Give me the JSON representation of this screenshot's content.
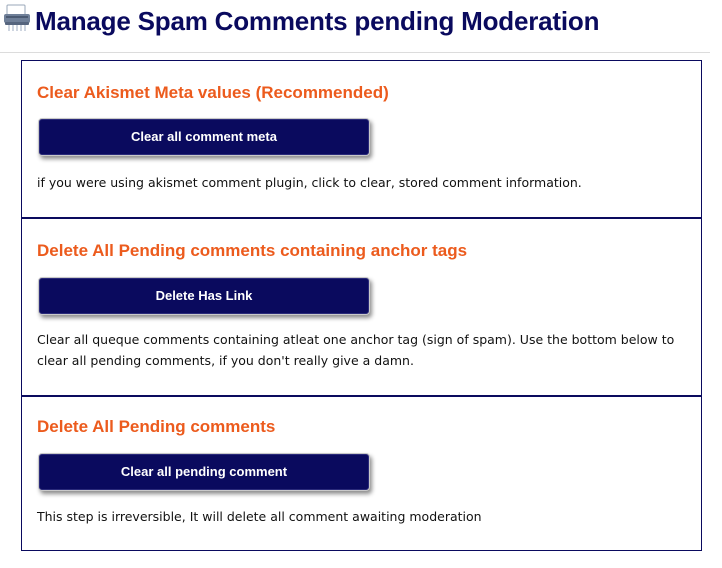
{
  "header": {
    "icon": "shredder-icon",
    "title": "Manage Spam Comments pending Moderation"
  },
  "sections": [
    {
      "title": "Clear Akismet Meta values (Recommended)",
      "button_label": "Clear all comment meta",
      "description": "if you were using akismet comment plugin, click to clear, stored comment information."
    },
    {
      "title": "Delete All Pending comments containing anchor tags",
      "button_label": "Delete Has Link",
      "description": "Clear all queque comments containing atleat one anchor tag (sign of spam). Use the bottom below to clear all pending comments, if you don't really give a damn."
    },
    {
      "title": "Delete All Pending comments",
      "button_label": "Clear all pending comment",
      "description": "This step is irreversible, It will delete all comment awaiting moderation"
    }
  ],
  "colors": {
    "title_text": "#0a0a5e",
    "section_title": "#ec5b1d",
    "button_bg": "#0a0a5e",
    "border": "#0a0a5e"
  }
}
